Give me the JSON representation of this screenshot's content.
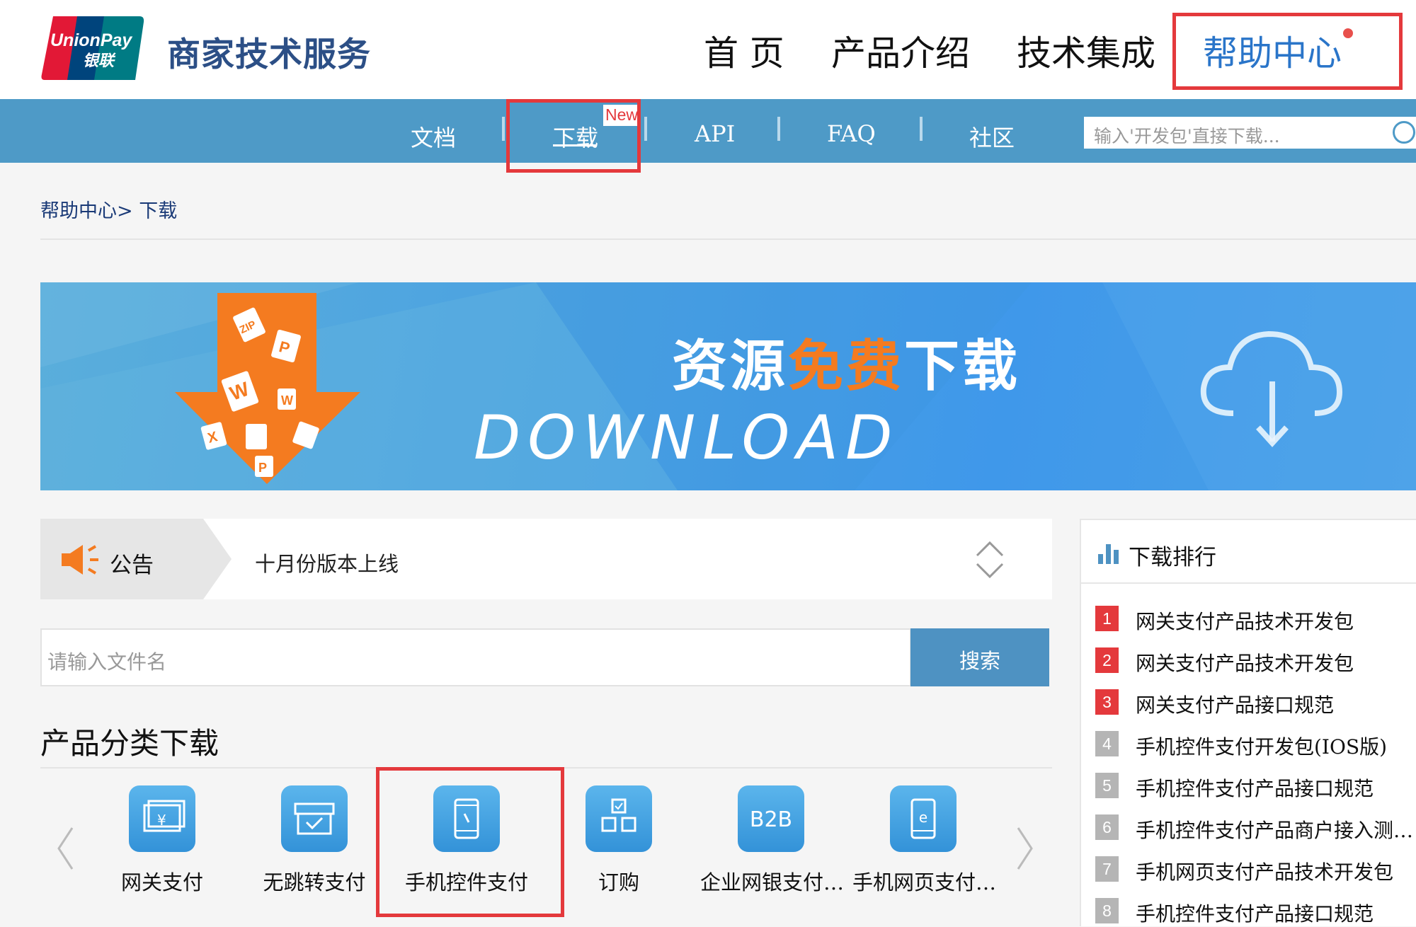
{
  "header": {
    "logo": {
      "line1": "UnionPay",
      "line2": "银联"
    },
    "brand": "商家技术服务",
    "nav": [
      "首 页",
      "产品介绍",
      "技术集成",
      "帮助中心"
    ],
    "active_nav": "帮助中心"
  },
  "subnav": {
    "items": [
      "文档",
      "下载",
      "API",
      "FAQ",
      "社区"
    ],
    "new_badge": "New",
    "search_placeholder": "输入'开发包'直接下载..."
  },
  "breadcrumb": "帮助中心> 下载",
  "banner": {
    "title_pre": "资源",
    "title_highlight": "免费",
    "title_post": "下载",
    "subtitle": "DOWNLOAD",
    "file_labels": [
      "ZIP",
      "P",
      "W",
      "W",
      "X",
      "P"
    ]
  },
  "notice": {
    "label": "公告",
    "text": "十月份版本上线"
  },
  "file_search": {
    "placeholder": "请输入文件名",
    "button": "搜索"
  },
  "categories": {
    "title": "产品分类下载",
    "items": [
      {
        "label": "网关支付",
        "icon": "card-icon"
      },
      {
        "label": "无跳转支付",
        "icon": "store-icon"
      },
      {
        "label": "手机控件支付",
        "icon": "mobile-icon"
      },
      {
        "label": "订购",
        "icon": "checkbox-icon"
      },
      {
        "label": "企业网银支付…",
        "icon": "b2b-icon",
        "icon_text": "B2B"
      },
      {
        "label": "手机网页支付…",
        "icon": "mobile-web-icon"
      }
    ]
  },
  "ranking": {
    "title": "下载排行",
    "items": [
      {
        "num": "1",
        "name": "网关支付产品技术开发包"
      },
      {
        "num": "2",
        "name": "网关支付产品技术开发包"
      },
      {
        "num": "3",
        "name": "网关支付产品接口规范"
      },
      {
        "num": "4",
        "name": "手机控件支付开发包(IOS版)"
      },
      {
        "num": "5",
        "name": "手机控件支付产品接口规范"
      },
      {
        "num": "6",
        "name": "手机控件支付产品商户接入测…"
      },
      {
        "num": "7",
        "name": "手机网页支付产品技术开发包"
      },
      {
        "num": "8",
        "name": "手机控件支付产品接口规范"
      }
    ]
  },
  "colors": {
    "accent_red": "#e4393c",
    "nav_blue": "#4e9ac7",
    "rank_top": "#e4393c",
    "rank_other": "#b5b5b5",
    "orange": "#f47b20"
  }
}
